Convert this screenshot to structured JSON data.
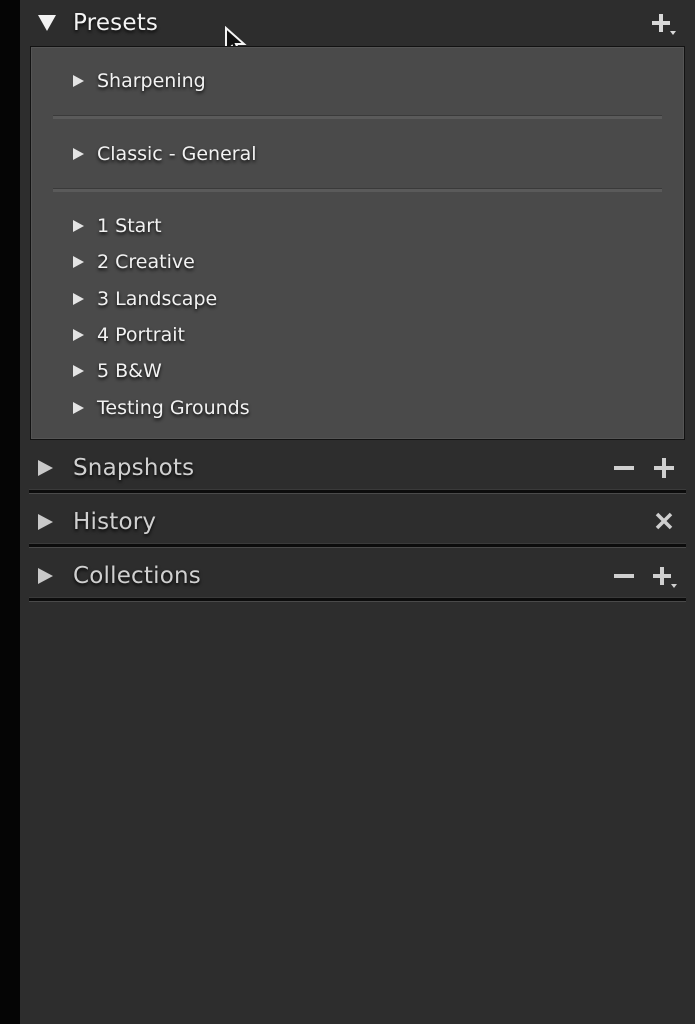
{
  "panels": {
    "presets": {
      "title": "Presets",
      "expanded": true,
      "actions": [
        "plus-dropdown-icon"
      ],
      "groups": [
        {
          "items": [
            {
              "label": "Sharpening"
            }
          ]
        },
        {
          "items": [
            {
              "label": "Classic - General"
            }
          ]
        },
        {
          "items": [
            {
              "label": "1 Start"
            },
            {
              "label": "2 Creative"
            },
            {
              "label": "3 Landscape"
            },
            {
              "label": "4 Portrait"
            },
            {
              "label": "5 B&W"
            },
            {
              "label": "Testing Grounds"
            }
          ]
        }
      ]
    },
    "snapshots": {
      "title": "Snapshots",
      "expanded": false,
      "actions": [
        "minus-icon",
        "plus-icon"
      ]
    },
    "history": {
      "title": "History",
      "expanded": false,
      "actions": [
        "close-icon"
      ]
    },
    "collections": {
      "title": "Collections",
      "expanded": false,
      "actions": [
        "minus-icon",
        "plus-dropdown-icon"
      ]
    }
  },
  "colors": {
    "background": "#2d2d2d",
    "presets_body": "#4a4a4a",
    "left_strip": "#050505",
    "text_active": "#f3f3f3",
    "text_collapsed": "#d0d0d0"
  }
}
